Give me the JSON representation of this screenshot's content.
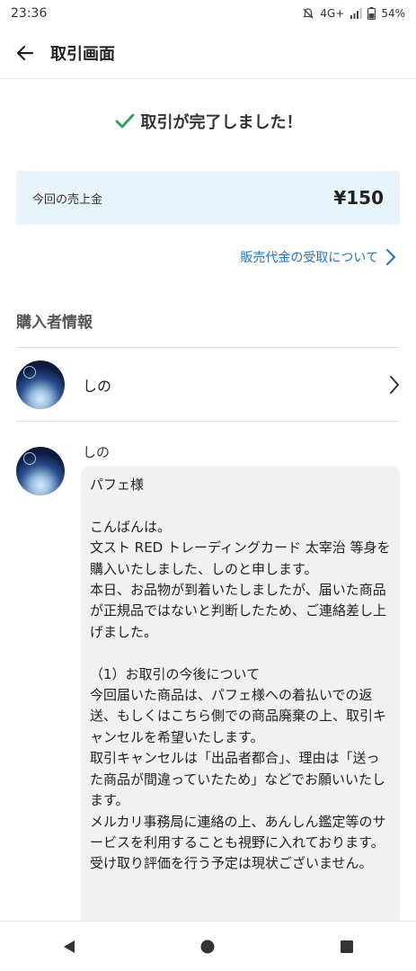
{
  "status": {
    "time": "23:36",
    "network": "4G+",
    "battery": "54%"
  },
  "header": {
    "title": "取引画面"
  },
  "completion": {
    "message": "取引が完了しました！"
  },
  "sales": {
    "label": "今回の売上金",
    "amount": "¥150"
  },
  "payout_link": {
    "label": "販売代金の受取について"
  },
  "buyer_section": {
    "title": "購入者情報",
    "name": "しの"
  },
  "message": {
    "sender": "しの",
    "body": "パフェ様\n\nこんばんは。\n文スト RED トレーディングカード 太宰治 等身を購入いたしました、しのと申します。\n本日、お品物が到着いたしましたが、届いた商品が正規品ではないと判断したため、ご連絡差し上げました。\n\n（1）お取引の今後について\n今回届いた商品は、パフェ様への着払いでの返送、もしくはこちら側での商品廃棄の上、取引キャンセルを希望いたします。\n取引キャンセルは「出品者都合」、理由は「送った商品が間違っていたため」などでお願いいたします。\nメルカリ事務局に連絡の上、あんしん鑑定等のサービスを利用することも視野に入れております。\n受け取り評価を行う予定は現状ございません。"
  },
  "colors": {
    "accent_link": "#1a73c8",
    "check": "#2e9e5b",
    "sales_bg": "#e8f4fb"
  },
  "icons": [
    "back-arrow-icon",
    "check-icon",
    "chevron-right-icon",
    "nav-back-icon",
    "nav-home-icon",
    "nav-recents-icon"
  ]
}
